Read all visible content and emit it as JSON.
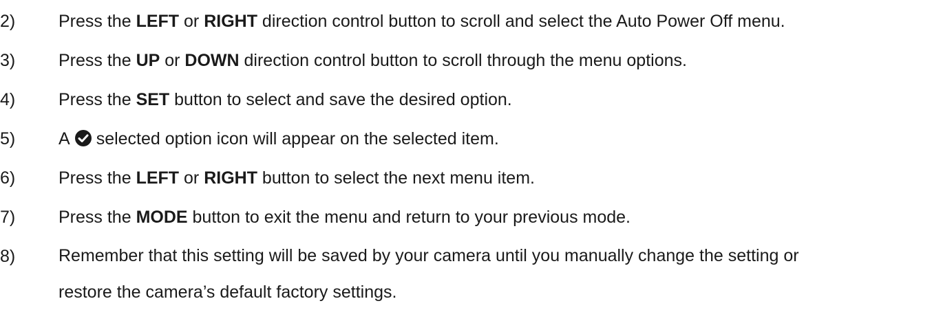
{
  "steps": [
    {
      "number": "2)",
      "parts": [
        "Press the ",
        "LEFT",
        " or ",
        "RIGHT",
        " direction control button to scroll and select the Auto Power Off menu."
      ]
    },
    {
      "number": "3)",
      "parts": [
        "Press the ",
        "UP",
        " or ",
        "DOWN",
        " direction control button to scroll through the menu options."
      ]
    },
    {
      "number": "4)",
      "parts": [
        "Press the ",
        "SET",
        " button to select and save the desired option."
      ]
    },
    {
      "number": "5)",
      "parts": [
        "A",
        "selected option icon will appear on the selected item."
      ],
      "icon": "check-circle-icon"
    },
    {
      "number": "6)",
      "parts": [
        "Press the ",
        "LEFT",
        " or ",
        "RIGHT",
        " button to select the next menu item."
      ]
    },
    {
      "number": "7)",
      "parts": [
        "Press the ",
        "MODE",
        " button to exit the menu and return to your previous mode."
      ]
    },
    {
      "number": "8)",
      "parts": [
        "Remember that this setting will be saved by your camera until you manually change the setting or restore the camera’s default factory settings."
      ]
    }
  ]
}
